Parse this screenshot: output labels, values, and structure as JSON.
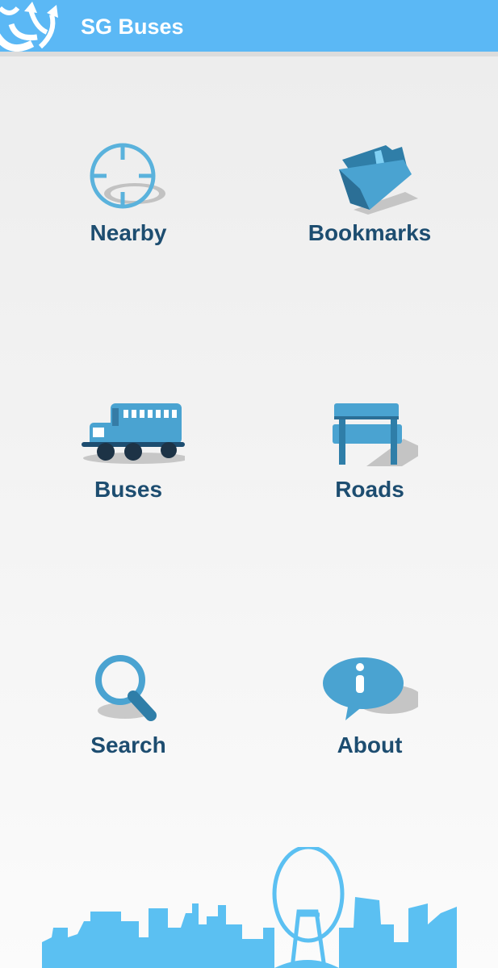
{
  "app": {
    "title": "SG Buses",
    "logo_icon": "bus-arrows-logo-icon",
    "bar_color": "#5bb8f5"
  },
  "menu": [
    {
      "label": "Nearby",
      "icon": "crosshair-icon"
    },
    {
      "label": "Bookmarks",
      "icon": "folder-bookmark-icon"
    },
    {
      "label": "Buses",
      "icon": "bus-icon"
    },
    {
      "label": "Roads",
      "icon": "road-sign-icon"
    },
    {
      "label": "Search",
      "icon": "magnifier-icon"
    },
    {
      "label": "About",
      "icon": "info-bubble-icon"
    }
  ],
  "colors": {
    "label_text": "#1d4d70",
    "icon_blue": "#4aa3d1",
    "skyline": "#5bc0f2"
  },
  "footer": {
    "illustration": "singapore-skyline-illustration"
  }
}
